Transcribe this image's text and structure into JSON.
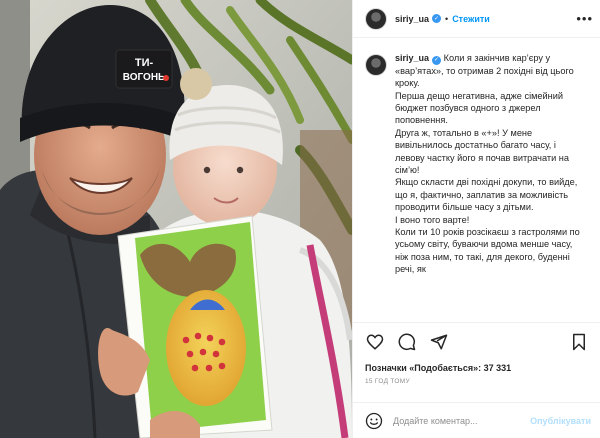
{
  "photo": {
    "hat_text_line1": "ТИ-",
    "hat_text_line2": "ВОГОНЬ"
  },
  "header": {
    "username": "siriy_ua",
    "verified_icon": "verified-check-icon",
    "separator": "•",
    "follow_label": "Стежити",
    "more_icon": "more-options-icon"
  },
  "caption": {
    "username": "siriy_ua",
    "paragraphs": [
      "Коли я закінчив кар’єру у «вар’ятах», то отримав 2 похідні від цього кроку.",
      "Перша дещо негативна, адже сімейний бюджет позбувся одного з джерел поповнення.",
      "Друга ж, тотально в «+»! У мене вивільнилось достатньо багато часу, і левову частку його я почав витрачати на сім’ю!",
      "Якщо скласти дві похідні докупи, то вийде, що я, фактично, заплатив за можливість проводити більше часу з дітьми.",
      "І воно того варте!",
      "Коли ти 10 років розсікаєш з гастролями по усьому світу, буваючи вдома менше часу, ніж поза ним, то такі, для декого, буденні речі, як"
    ]
  },
  "actions": {
    "icons": [
      "heart-icon",
      "comment-icon",
      "share-icon",
      "bookmark-icon"
    ],
    "likes_label": "Позначки «Подобається»: 37 331",
    "time_ago": "15 ГОД ТОМУ"
  },
  "comment_box": {
    "emoji_icon": "emoji-icon",
    "placeholder": "Додайте коментар...",
    "publish_label": "Опублікувати"
  },
  "colors": {
    "accent": "#0095f6",
    "publish_disabled": "#b2dffc",
    "muted": "#8e8e8e",
    "text": "#262626"
  }
}
